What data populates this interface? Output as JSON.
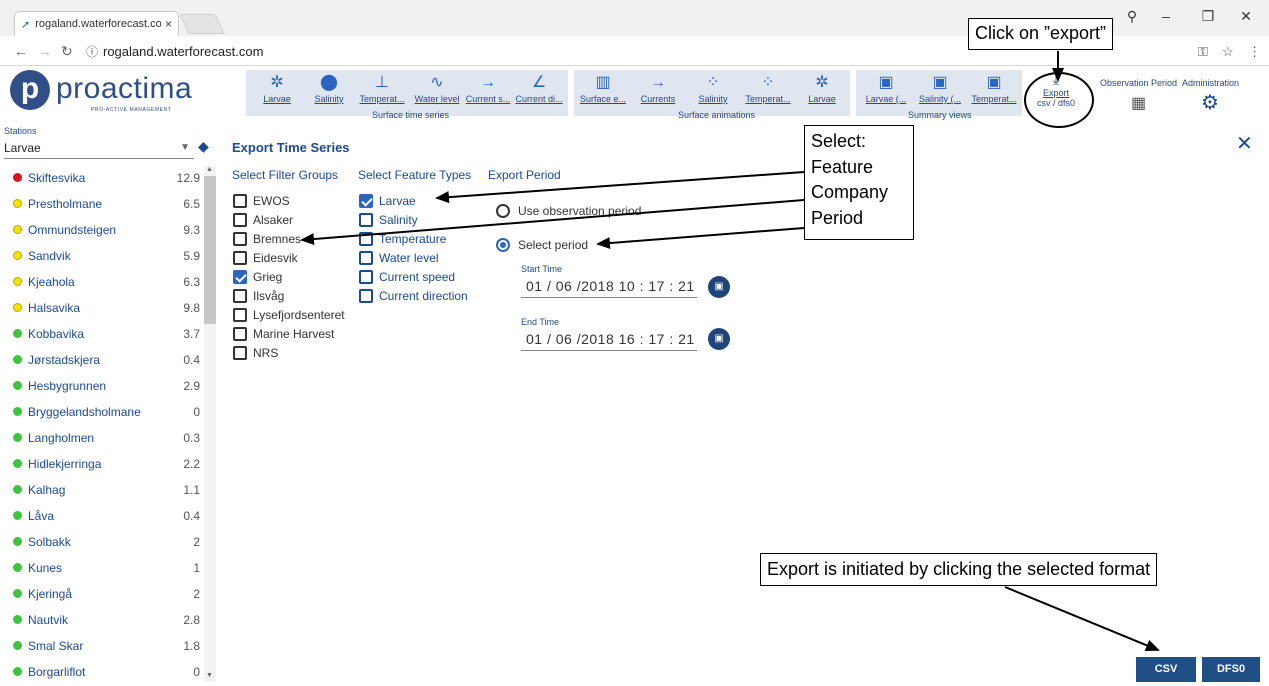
{
  "browser": {
    "tab_title": "rogaland.waterforecast.co",
    "tab_close": "×",
    "url": "rogaland.waterforecast.com",
    "win_min": "–",
    "win_max": "❐",
    "win_close": "✕"
  },
  "logo": {
    "letter": "p",
    "word": "proactima",
    "sub": "PRO-ACTIVE MANAGEMENT"
  },
  "toolbar": {
    "surface_time_series": {
      "caption": "Surface time series",
      "items": [
        "Larvae",
        "Salinity",
        "Temperat...",
        "Water level",
        "Current s...",
        "Current di..."
      ]
    },
    "surface_animations": {
      "caption": "Surface animations",
      "items": [
        "Surface e...",
        "Currents",
        "Salinity",
        "Temperat...",
        "Larvae"
      ]
    },
    "summary_views": {
      "caption": "Summary views",
      "items": [
        "Larvae (...",
        "Salinity (...",
        "Temperat..."
      ]
    },
    "export": {
      "label": "Export",
      "sub": "csv / dfs0"
    },
    "observation_period": "Observation Period",
    "administration": "Administration"
  },
  "sidebar": {
    "label": "Stations",
    "selected": "Larvae",
    "stations": [
      {
        "name": "Skiftesvika",
        "value": "12.9",
        "status_color": "#d8121a"
      },
      {
        "name": "Prestholmane",
        "value": "6.5",
        "status_color": "#f2e300"
      },
      {
        "name": "Ommundsteigen",
        "value": "9.3",
        "status_color": "#f2e300"
      },
      {
        "name": "Sandvik",
        "value": "5.9",
        "status_color": "#f2e300"
      },
      {
        "name": "Kjeahola",
        "value": "6.3",
        "status_color": "#f2e300"
      },
      {
        "name": "Halsavika",
        "value": "9.8",
        "status_color": "#f2e300"
      },
      {
        "name": "Kobbavika",
        "value": "3.7",
        "status_color": "#3cc43c"
      },
      {
        "name": "Jørstadskjera",
        "value": "0.4",
        "status_color": "#3cc43c"
      },
      {
        "name": "Hesbygrunnen",
        "value": "2.9",
        "status_color": "#3cc43c"
      },
      {
        "name": "Bryggelandsholmane",
        "value": "0",
        "status_color": "#3cc43c"
      },
      {
        "name": "Langholmen",
        "value": "0.3",
        "status_color": "#3cc43c"
      },
      {
        "name": "Hidlekjerringa",
        "value": "2.2",
        "status_color": "#3cc43c"
      },
      {
        "name": "Kalhag",
        "value": "1.1",
        "status_color": "#3cc43c"
      },
      {
        "name": "Låva",
        "value": "0.4",
        "status_color": "#3cc43c"
      },
      {
        "name": "Solbakk",
        "value": "2",
        "status_color": "#3cc43c"
      },
      {
        "name": "Kunes",
        "value": "1",
        "status_color": "#3cc43c"
      },
      {
        "name": "Kjeringå",
        "value": "2",
        "status_color": "#3cc43c"
      },
      {
        "name": "Nautvik",
        "value": "2.8",
        "status_color": "#3cc43c"
      },
      {
        "name": "Smal Skar",
        "value": "1.8",
        "status_color": "#3cc43c"
      },
      {
        "name": "Borgarliflot",
        "value": "0",
        "status_color": "#3cc43c"
      }
    ]
  },
  "main": {
    "title": "Export Time Series",
    "filter_groups": {
      "heading": "Select Filter Groups",
      "items": [
        {
          "label": "EWOS",
          "checked": false
        },
        {
          "label": "Alsaker",
          "checked": false
        },
        {
          "label": "Bremnes",
          "checked": false
        },
        {
          "label": "Eidesvik",
          "checked": false
        },
        {
          "label": "Grieg",
          "checked": true
        },
        {
          "label": "Ilsvåg",
          "checked": false
        },
        {
          "label": "Lysefjordsenteret",
          "checked": false
        },
        {
          "label": "Marine Harvest",
          "checked": false
        },
        {
          "label": "NRS",
          "checked": false
        }
      ]
    },
    "feature_types": {
      "heading": "Select Feature Types",
      "items": [
        {
          "label": "Larvae",
          "checked": true
        },
        {
          "label": "Salinity",
          "checked": false
        },
        {
          "label": "Temperature",
          "checked": false
        },
        {
          "label": "Water level",
          "checked": false
        },
        {
          "label": "Current speed",
          "checked": false
        },
        {
          "label": "Current direction",
          "checked": false
        }
      ]
    },
    "export_period": {
      "heading": "Export Period",
      "option_observation": "Use observation period",
      "option_select": "Select period",
      "selected": "Select period",
      "start_label": "Start Time",
      "start_value": "01 / 06 /2018  10 : 17 : 21",
      "end_label": "End Time",
      "end_value": "01 / 06 /2018  16 : 17 : 21"
    },
    "formats": [
      "CSV",
      "DFS0"
    ]
  },
  "annotations": {
    "click_export": "Click on ”export”",
    "select_lines": [
      "Select:",
      "Feature",
      "Company",
      "Period"
    ],
    "export_initiated": "Export is initiated by clicking the selected format"
  }
}
